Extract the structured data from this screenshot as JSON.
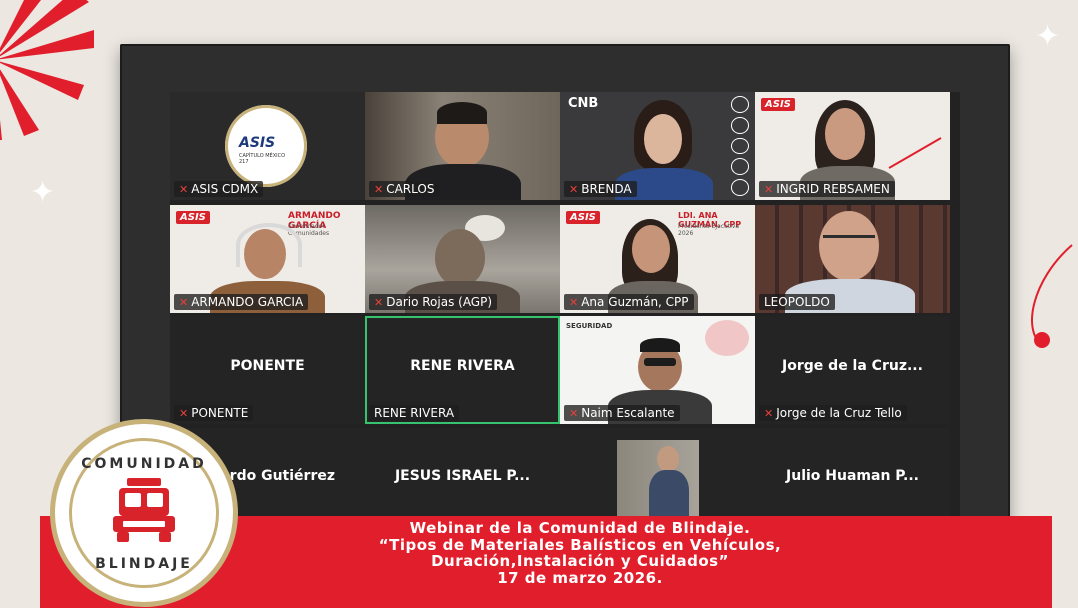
{
  "participants": [
    {
      "name": "ASIS CDMX"
    },
    {
      "name": "CARLOS"
    },
    {
      "name": "BRENDA"
    },
    {
      "name": "INGRID REBSAMEN"
    },
    {
      "name": "ARMANDO GARCIA"
    },
    {
      "name": "Dario Rojas (AGP)"
    },
    {
      "name": "Ana Guzmán, CPP"
    },
    {
      "name": "LEOPOLDO"
    },
    {
      "name": "PONENTE",
      "display": "PONENTE"
    },
    {
      "name": "RENE RIVERA",
      "display": "RENE RIVERA"
    },
    {
      "name": "Naim Escalante"
    },
    {
      "name": "Jorge de la Cruz Tello",
      "display": "Jorge de la Cruz..."
    },
    {
      "display": "ardo Gutiérrez"
    },
    {
      "display": "JESUS ISRAEL P..."
    },
    {
      "display": ""
    },
    {
      "display": "Julio Huaman P..."
    }
  ],
  "slide_texts": {
    "armando_title": "ARMANDO GARCÍA",
    "armando_sub": "Coordinador Comunidades",
    "ana_title": "LDI. ANA GUZMÁN, CPP",
    "ana_sub": "Presidenta Ejecutiva 2026",
    "asis_logo": "ASIS",
    "asis_sub": "CAPÍTULO MÉXICO 217",
    "cnb_logo": "CNB",
    "seguridad": "SEGURIDAD"
  },
  "banner": {
    "line1": "Webinar de la Comunidad de Blindaje.",
    "line2": "“Tipos de Materiales Balísticos en Vehículos,",
    "line3": "Duración,Instalación y Cuidados”",
    "line4": "17 de marzo 2026."
  },
  "badge": {
    "top_text": "COMUNIDAD",
    "bottom_text": "BLINDAJE"
  },
  "colors": {
    "brand_red": "#e11f2c",
    "gold": "#c7b27a",
    "active_speaker": "#37c26d"
  }
}
